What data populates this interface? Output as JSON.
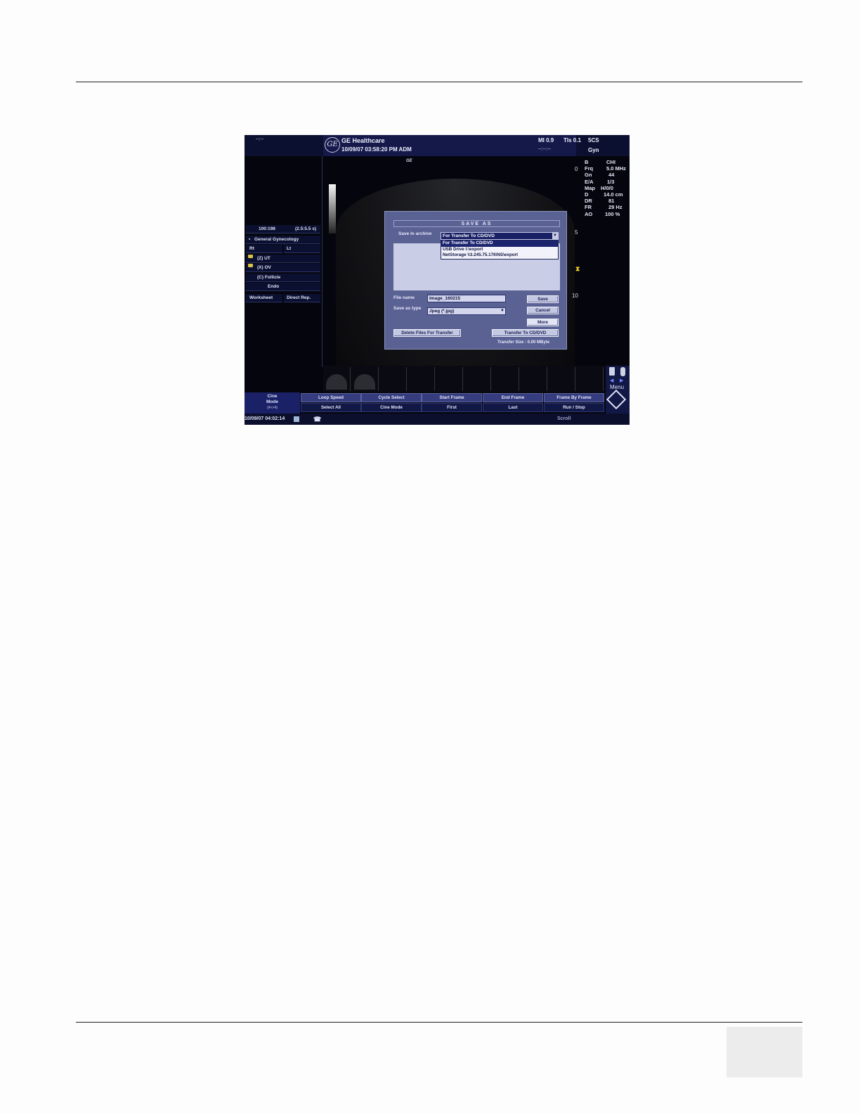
{
  "header": {
    "left_indicator": "--:--",
    "brand": "GE Healthcare",
    "datetime_user": "10/09/07 03:58:20 PM ADM",
    "logo_text": "GE",
    "mi": "MI 0.9",
    "tis": "TIs 0.1",
    "probe": "5CS",
    "time_placeholder": "--:--:--",
    "preset": "Gyn"
  },
  "image": {
    "ge_mark": "GE"
  },
  "params": {
    "rows": [
      {
        "label": "B",
        "value": "CHI"
      },
      {
        "label": "Frq",
        "value": "5.0 MHz"
      },
      {
        "label": "Gn",
        "value": "44"
      },
      {
        "label": "E/A",
        "value": "1/3"
      },
      {
        "label": "Map",
        "value": "H/0/0"
      },
      {
        "label": "D",
        "value": "14.0 cm"
      },
      {
        "label": "DR",
        "value": "81"
      },
      {
        "label": "FR",
        "value": "29 Hz"
      },
      {
        "label": "AO",
        "value": "100 %"
      }
    ]
  },
  "depth_scale": {
    "d0": "0",
    "d5": "5",
    "d10": "10"
  },
  "left_panel": {
    "cine_counter": "100:198",
    "cine_range": "(2.5:5.5 s)",
    "study": "General Gynecology",
    "rt": "Rt",
    "lt": "Lt",
    "items": [
      {
        "label": "(Z)  UT"
      },
      {
        "label": "(X)  OV"
      },
      {
        "label": "(C)  Follicle"
      },
      {
        "label": "Endo"
      }
    ],
    "worksheet": "Worksheet",
    "direct_rep": "Direct Rep."
  },
  "dialog": {
    "title": "SAVE AS",
    "save_in_label": "Save in archive",
    "save_in_value": "For Transfer To CD/DVD",
    "archive_options": [
      "For Transfer To CD/DVD",
      "USB Drive    I:\\export",
      "NetStorage    \\\\3.245.75.176\\NS\\export"
    ],
    "file_name_label": "File name",
    "file_name_value": "Image_160215",
    "save_type_label": "Save as type",
    "save_type_value": "Jpeg  (*.jpg)",
    "save_button": "Save",
    "cancel_button": "Cancel",
    "more_button": "More",
    "delete_button": "Delete Files For Transfer",
    "transfer_button": "Transfer To CD/DVD",
    "transfer_size": "Transfer Size : 0.00 MByte"
  },
  "softkeys": {
    "cine_mode_title": "Cine",
    "cine_mode_title2": "Mode",
    "cine_mode_sub": "(4<>4)",
    "top": [
      "Loop Speed",
      "Cycle Select",
      "Start Frame",
      "End Frame",
      "Frame By Frame"
    ],
    "bottom": [
      "Select All",
      "Cine Mode",
      "First",
      "Last",
      "Run / Stop"
    ]
  },
  "menu": {
    "label": "Menu"
  },
  "status": {
    "datetime": "10/09/07 04:02:14",
    "scroll": "Scroll"
  }
}
